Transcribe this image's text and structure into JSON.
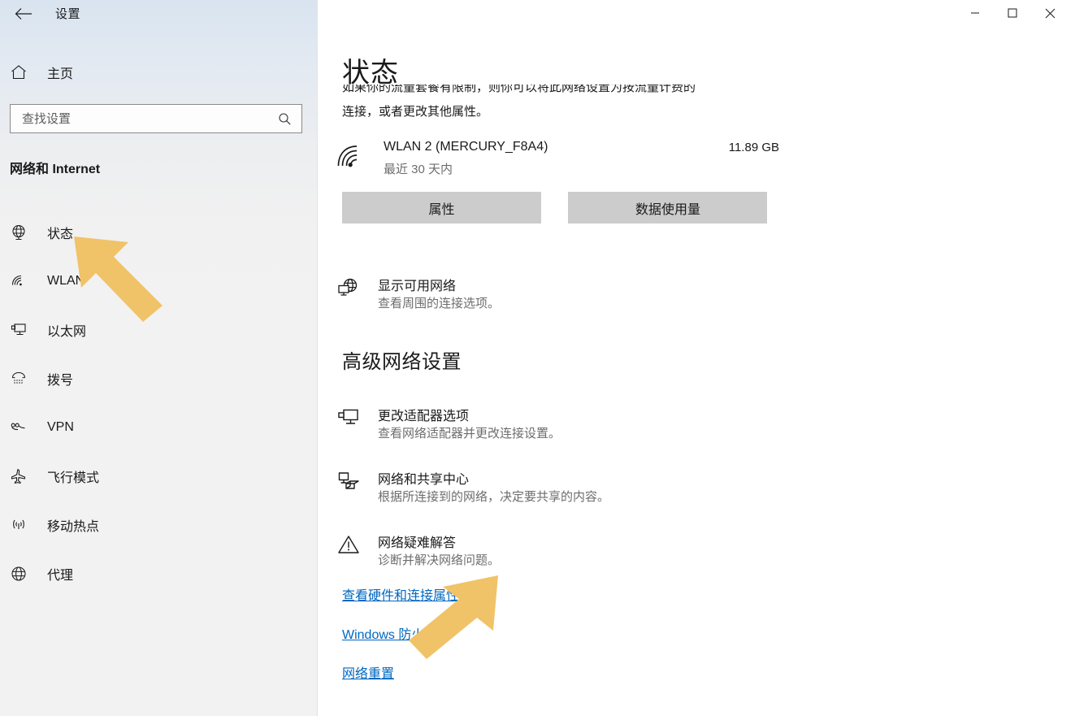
{
  "titlebar": {
    "back_label": "back-arrow",
    "title": "设置",
    "minimize": "minimize",
    "maximize": "maximize",
    "close": "close"
  },
  "sidebar": {
    "home_label": "主页",
    "search": {
      "placeholder": "查找设置",
      "value": ""
    },
    "category_title": "网络和 Internet",
    "items": [
      {
        "label": "状态",
        "icon": "globe-status-icon"
      },
      {
        "label": "WLAN",
        "icon": "wifi-icon"
      },
      {
        "label": "以太网",
        "icon": "ethernet-icon"
      },
      {
        "label": "拨号",
        "icon": "dialup-icon"
      },
      {
        "label": "VPN",
        "icon": "vpn-icon"
      },
      {
        "label": "飞行模式",
        "icon": "airplane-icon"
      },
      {
        "label": "移动热点",
        "icon": "hotspot-icon"
      },
      {
        "label": "代理",
        "icon": "proxy-globe-icon"
      }
    ]
  },
  "main": {
    "page_title": "状态",
    "description_line1": "如果你的流量套餐有限制，则你可以将此网络设置为按流量计费的",
    "description_line2": "连接，或者更改其他属性。",
    "network": {
      "name": "WLAN 2 (MERCURY_F8A4)",
      "period": "最近 30 天内",
      "usage": "11.89 GB",
      "icon": "wifi-signal-icon"
    },
    "buttons": {
      "properties": "属性",
      "data_usage": "数据使用量"
    },
    "available_networks": {
      "title": "显示可用网络",
      "subtitle": "查看周围的连接选项。",
      "icon": "globe-monitor-icon"
    },
    "advanced_title": "高级网络设置",
    "advanced_items": [
      {
        "title": "更改适配器选项",
        "subtitle": "查看网络适配器并更改连接设置。",
        "icon": "monitor-icon"
      },
      {
        "title": "网络和共享中心",
        "subtitle": "根据所连接到的网络，决定要共享的内容。",
        "icon": "share-folder-icon"
      },
      {
        "title": "网络疑难解答",
        "subtitle": "诊断并解决网络问题。",
        "icon": "warning-triangle-icon"
      }
    ],
    "links": [
      "查看硬件和连接属性",
      "Windows 防火墙",
      "网络重置"
    ]
  },
  "annotations": {
    "arrow_color": "#f0c368",
    "arrow_sidebar_target": "状态",
    "arrow_links_target": "Windows 防火墙"
  },
  "colors": {
    "link": "#0067c0",
    "button_bg": "#cccccc",
    "sidebar_bg": "#f2f2f2",
    "text": "#1a1a1a",
    "muted_text": "#6d6d6d"
  }
}
